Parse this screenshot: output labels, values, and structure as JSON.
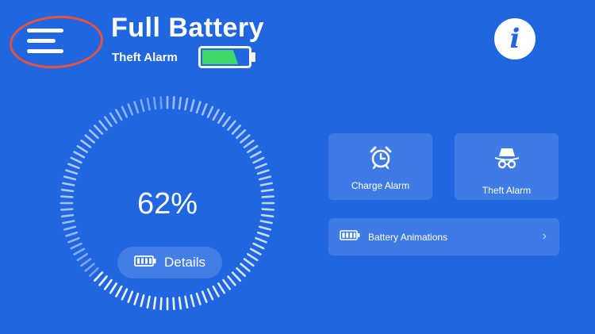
{
  "header": {
    "title": "Full Battery",
    "subtitle": "Theft Alarm"
  },
  "gauge": {
    "percent_label": "62%",
    "level": 0.62
  },
  "details_button": {
    "label": "Details"
  },
  "cards": {
    "charge_alarm": {
      "label": "Charge Alarm",
      "icon": "alarm-clock-icon"
    },
    "theft_alarm": {
      "label": "Theft Alarm",
      "icon": "spy-hat-icon"
    }
  },
  "battery_animations": {
    "label": "Battery Animations",
    "icon": "battery-icon"
  },
  "colors": {
    "background": "#1f66e0",
    "battery_fill": "#3dd96b",
    "highlight_ring": "#e8513c"
  }
}
